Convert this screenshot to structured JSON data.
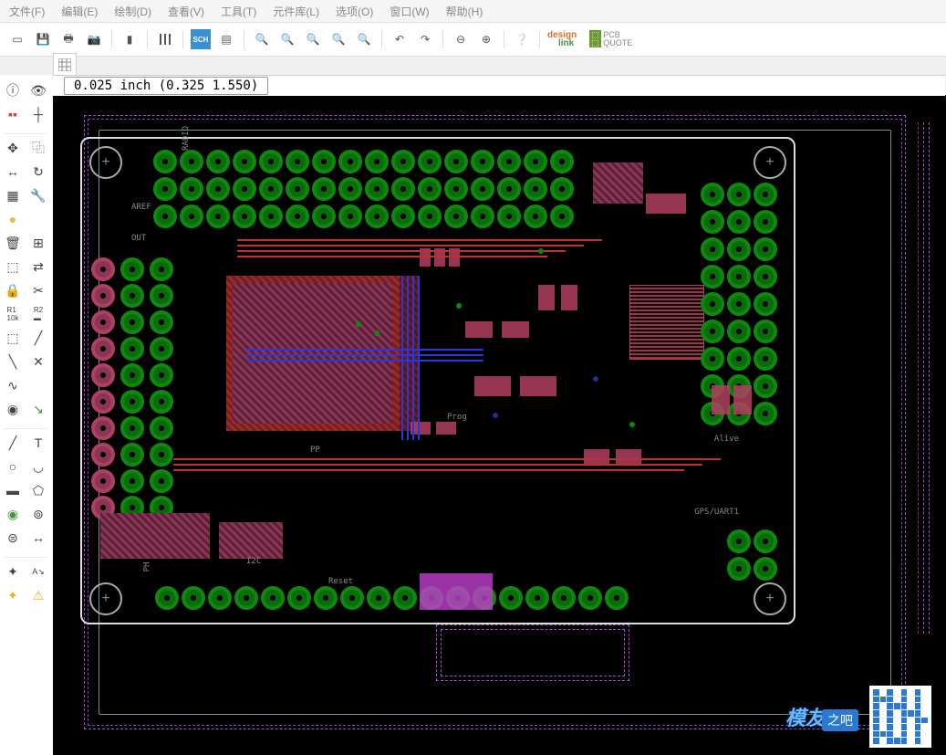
{
  "menu": {
    "file": "文件(F)",
    "edit": "编辑(E)",
    "draw": "绘制(D)",
    "view": "查看(V)",
    "tools": "工具(T)",
    "library": "元件库(L)",
    "options": "选项(O)",
    "window": "窗口(W)",
    "help": "帮助(H)"
  },
  "coord_display": "0.025  inch  (0.325  1.550)",
  "toolbar_icons": [
    "new",
    "open",
    "save",
    "print",
    "cam",
    "3d",
    "bars",
    "sch",
    "layers",
    "zoom-out",
    "zoom-in",
    "zoom-fit",
    "zoom-win",
    "zoom-sel",
    "undo",
    "redo",
    "minus",
    "plus",
    "help"
  ],
  "logos": {
    "designlink": "design",
    "designlink2": "link",
    "pcbquote1": "PCB",
    "pcbquote2": "QUOTE"
  },
  "silkscreen": {
    "radio": "RADIO",
    "aref": "AREF",
    "out": "OUT",
    "reset": "Reset",
    "i2c": "I2C",
    "ph": "PH",
    "pp": "PP",
    "alive": "Alive",
    "gps": "GPS/UART1",
    "prog": "Prog"
  },
  "watermark": {
    "brand": "模友",
    "suffix": "之吧"
  },
  "grid_unit": "inch",
  "grid_step": 0.025,
  "cursor_x": 0.325,
  "cursor_y": 1.55
}
